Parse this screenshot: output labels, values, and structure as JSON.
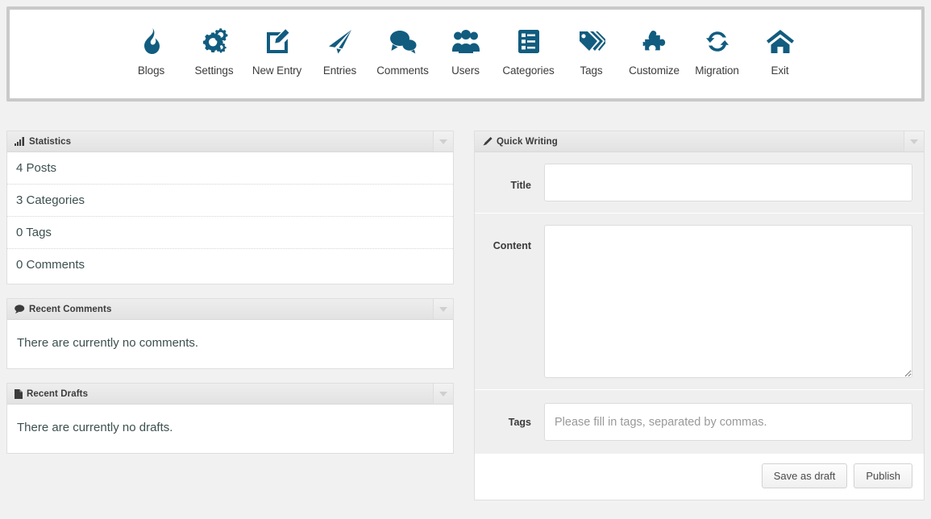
{
  "toolbar": {
    "items": [
      {
        "label": "Blogs",
        "icon": "flame-icon"
      },
      {
        "label": "Settings",
        "icon": "gears-icon"
      },
      {
        "label": "New Entry",
        "icon": "pencil-square-icon"
      },
      {
        "label": "Entries",
        "icon": "paper-plane-icon"
      },
      {
        "label": "Comments",
        "icon": "comments-icon"
      },
      {
        "label": "Users",
        "icon": "users-icon"
      },
      {
        "label": "Categories",
        "icon": "list-box-icon"
      },
      {
        "label": "Tags",
        "icon": "tags-icon"
      },
      {
        "label": "Customize",
        "icon": "puzzle-piece-icon"
      },
      {
        "label": "Migration",
        "icon": "refresh-cycle-icon"
      },
      {
        "label": "Exit",
        "icon": "home-icon"
      }
    ]
  },
  "panels": {
    "statistics": {
      "title": "Statistics",
      "icon": "bar-chart-icon",
      "rows": [
        "4 Posts",
        "3 Categories",
        "0 Tags",
        "0 Comments"
      ]
    },
    "recent_comments": {
      "title": "Recent Comments",
      "icon": "comment-bubble-icon",
      "empty_message": "There are currently no comments."
    },
    "recent_drafts": {
      "title": "Recent Drafts",
      "icon": "file-icon",
      "empty_message": "There are currently no drafts."
    },
    "quick_writing": {
      "title": "Quick Writing",
      "icon": "pencil-icon",
      "fields": {
        "title": {
          "label": "Title",
          "value": "",
          "placeholder": ""
        },
        "content": {
          "label": "Content",
          "value": "",
          "placeholder": ""
        },
        "tags": {
          "label": "Tags",
          "value": "",
          "placeholder": "Please fill in tags, separated by commas."
        }
      },
      "buttons": {
        "save_draft": "Save as draft",
        "publish": "Publish"
      }
    }
  },
  "colors": {
    "icon_blue": "#115C7F",
    "page_background": "#f1f1f1",
    "panel_header": "#e6e6e6",
    "text_slate": "#3d4f4f"
  }
}
